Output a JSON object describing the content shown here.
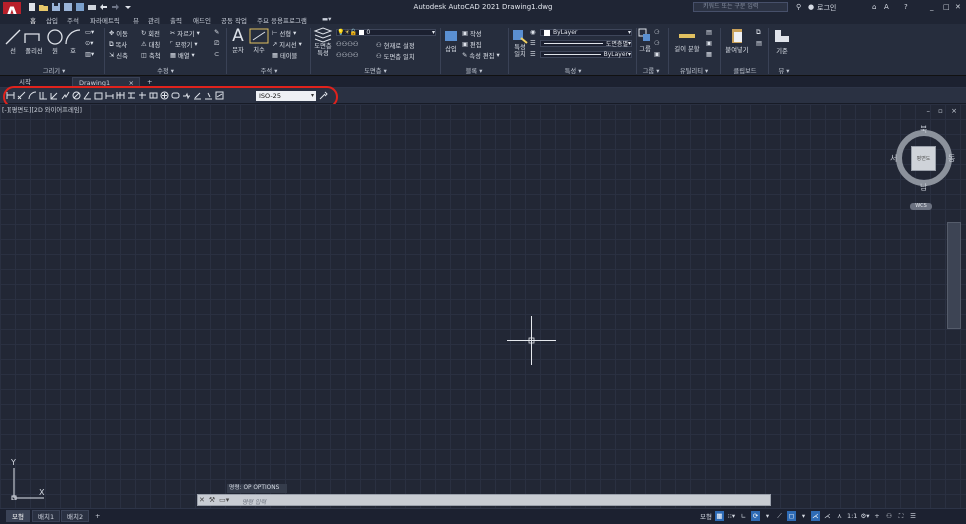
{
  "titlebar": {
    "logo": "A",
    "title": "Autodesk AutoCAD 2021   Drawing1.dwg",
    "search_placeholder": "키워드 또는 구문 입력",
    "login": "로그인"
  },
  "menubar": {
    "items": [
      "홈",
      "삽입",
      "주석",
      "파라메트릭",
      "뷰",
      "관리",
      "출력",
      "애드인",
      "공동 작업",
      "주요 응용프로그램"
    ],
    "active": "홈"
  },
  "ribbon": {
    "draw": {
      "label": "그리기 ▾",
      "line": "선",
      "polyline": "폴리선",
      "circle": "원",
      "arc": "호"
    },
    "modify": {
      "label": "수정 ▾",
      "move": "이동",
      "rotate": "회전",
      "trim": "자르기",
      "copy": "복사",
      "mirror": "대칭",
      "fillet": "모깎기",
      "stretch": "신축",
      "scale": "축척",
      "array": "배열"
    },
    "annotation": {
      "label": "주석 ▾",
      "text": "문자",
      "dimension": "치수",
      "leader": "지시선",
      "table": "테이블",
      "linear": "선형"
    },
    "layers": {
      "label": "도면층 ▾",
      "properties": "도면층 특성",
      "layer_value": "0",
      "make_current": "현재로 설정",
      "match": "도면층 일치"
    },
    "block": {
      "label": "블록 ▾",
      "insert": "삽입",
      "create": "작성",
      "edit": "편집",
      "edit_attr": "속성 편집"
    },
    "properties": {
      "label": "특성 ▾",
      "match": "특성 일치",
      "color": "ByLayer",
      "linetype": "도면층별",
      "lineweight": "ByLayer"
    },
    "groups": {
      "label": "그룹 ▾",
      "group": "그룹"
    },
    "utilities": {
      "label": "유틸리티 ▾",
      "measure": "길이 분할"
    },
    "clipboard": {
      "label": "클립보드",
      "paste": "붙여넣기"
    },
    "view": {
      "label": "뷰 ▾",
      "base": "기준"
    }
  },
  "file_tabs": {
    "start": "시작",
    "drawing": "Drawing1",
    "close": "×",
    "add": "+"
  },
  "dim_toolbar": {
    "style_value": "ISO-25"
  },
  "viewport": {
    "label": "[-][평면도][2D 와이어프레임]",
    "controls": "– ▫ ×"
  },
  "viewcube": {
    "north": "북",
    "south": "남",
    "east": "동",
    "west": "서",
    "center": "평면도",
    "wcs": "WCS"
  },
  "ucs": {
    "x": "X",
    "y": "Y"
  },
  "command": {
    "history": "명령: OP OPTIONS",
    "prompt": "명령 입력"
  },
  "status": {
    "layout_tabs": [
      "모형",
      "배치1",
      "배치2"
    ],
    "add": "+",
    "model": "모형",
    "scale": "1:1"
  },
  "colors": {
    "accent": "#2e6bb5",
    "highlight": "#e0221c",
    "canvas": "#222735",
    "logo": "#b8202b"
  }
}
